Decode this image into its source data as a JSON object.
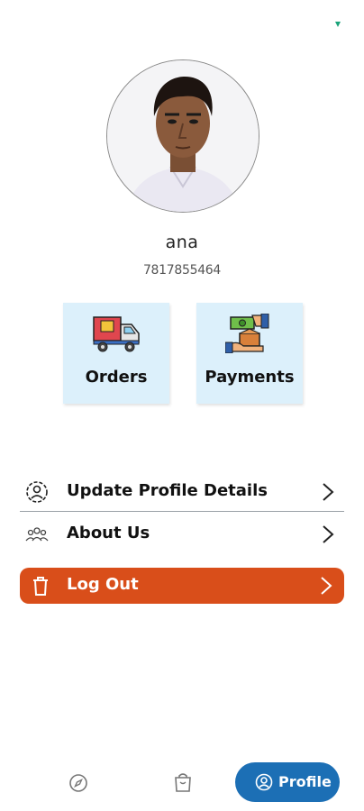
{
  "profile": {
    "name": "ana",
    "phone": "7817855464"
  },
  "tiles": {
    "orders": {
      "label": "Orders",
      "icon": "delivery-truck-icon"
    },
    "payments": {
      "label": "Payments",
      "icon": "cash-hand-icon"
    }
  },
  "menu": {
    "update_profile": {
      "label": "Update Profile Details",
      "icon": "user-settings-icon"
    },
    "about_us": {
      "label": "About Us",
      "icon": "group-icon"
    },
    "logout": {
      "label": "Log Out",
      "icon": "trash-icon"
    }
  },
  "bottom_nav": {
    "explore_icon": "compass-icon",
    "orders_icon": "shopping-bag-icon",
    "profile": {
      "label": "Profile",
      "icon": "user-circle-icon"
    }
  },
  "colors": {
    "tile_bg": "#dcf0fb",
    "logout_bg": "#d94e1a",
    "nav_active": "#1c6fb5"
  }
}
